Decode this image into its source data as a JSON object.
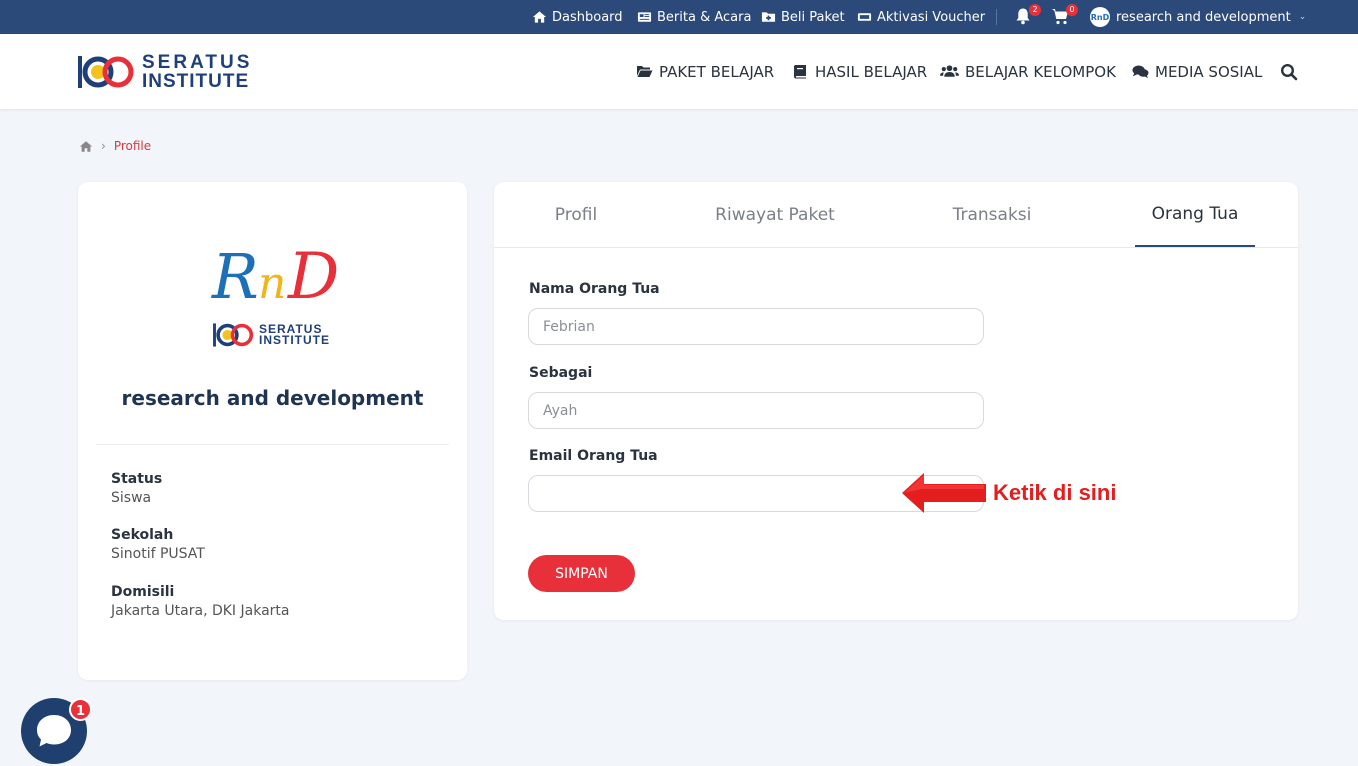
{
  "topbar": {
    "links": [
      {
        "label": "Dashboard",
        "icon": "home-icon"
      },
      {
        "label": "Berita & Acara",
        "icon": "newspaper-icon"
      },
      {
        "label": "Beli Paket",
        "icon": "folder-plus-icon"
      },
      {
        "label": "Aktivasi Voucher",
        "icon": "ticket-icon"
      }
    ],
    "notifications_count": "2",
    "cart_count": "0",
    "user_name": "research and development",
    "user_avatar_text": "RnD"
  },
  "header": {
    "logo_line1": "SERATUS",
    "logo_line2": "INSTITUTE",
    "nav": [
      {
        "label": "PAKET BELAJAR",
        "icon": "folder-open-icon"
      },
      {
        "label": "HASIL BELAJAR",
        "icon": "book-icon"
      },
      {
        "label": "BELAJAR KELOMPOK",
        "icon": "users-icon"
      },
      {
        "label": "MEDIA SOSIAL",
        "icon": "comments-icon"
      }
    ]
  },
  "breadcrumb": {
    "current": "Profile",
    "separator": "›"
  },
  "profile": {
    "logo_text": "RnD",
    "sub_logo_line1": "SERATUS",
    "sub_logo_line2": "INSTITUTE",
    "name": "research and development",
    "fields": [
      {
        "label": "Status",
        "value": "Siswa"
      },
      {
        "label": "Sekolah",
        "value": "Sinotif PUSAT"
      },
      {
        "label": "Domisili",
        "value": "Jakarta Utara, DKI Jakarta"
      }
    ]
  },
  "tabs": [
    {
      "label": "Profil",
      "active": false
    },
    {
      "label": "Riwayat Paket",
      "active": false
    },
    {
      "label": "Transaksi",
      "active": false
    },
    {
      "label": "Orang Tua",
      "active": true
    }
  ],
  "form": {
    "parent_name_label": "Nama Orang Tua",
    "parent_name_placeholder": "Febrian",
    "relation_label": "Sebagai",
    "relation_placeholder": "Ayah",
    "email_label": "Email Orang Tua",
    "email_value": "",
    "save_label": "SIMPAN"
  },
  "annotation": {
    "text": "Ketik di sini",
    "color": "#e41e1e"
  },
  "chat": {
    "badge": "1"
  },
  "colors": {
    "topbar": "#2b4a7a",
    "accent": "#e8303a",
    "brand": "#1f3f7a"
  }
}
